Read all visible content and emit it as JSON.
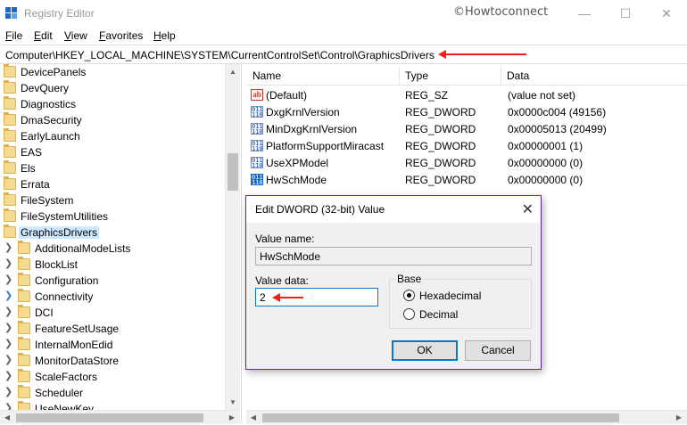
{
  "window": {
    "title": "Registry Editor",
    "watermark": "©Howtoconnect",
    "minimize": "—",
    "maximize": "☐",
    "close": "✕"
  },
  "menu": [
    {
      "label": "File",
      "u": "F",
      "rest": "ile"
    },
    {
      "label": "Edit",
      "u": "E",
      "rest": "dit"
    },
    {
      "label": "View",
      "u": "V",
      "rest": "iew"
    },
    {
      "label": "Favorites",
      "u": "F",
      "rest": "avorites"
    },
    {
      "label": "Help",
      "u": "H",
      "rest": "elp"
    }
  ],
  "address": "Computer\\HKEY_LOCAL_MACHINE\\SYSTEM\\CurrentControlSet\\Control\\GraphicsDrivers",
  "tree": {
    "level1": [
      "DevicePanels",
      "DevQuery",
      "Diagnostics",
      "DmaSecurity",
      "EarlyLaunch",
      "EAS",
      "Els",
      "Errata",
      "FileSystem",
      "FileSystemUtilities",
      "GraphicsDrivers"
    ],
    "level2": [
      "AdditionalModeLists",
      "BlockList",
      "Configuration",
      "Connectivity",
      "DCI",
      "FeatureSetUsage",
      "InternalMonEdid",
      "MonitorDataStore",
      "ScaleFactors",
      "Scheduler",
      "UseNewKey"
    ]
  },
  "list": {
    "headers": {
      "name": "Name",
      "type": "Type",
      "data": "Data"
    },
    "rows": [
      {
        "name": "(Default)",
        "type": "REG_SZ",
        "data": "(value not set)",
        "icon": "ab"
      },
      {
        "name": "DxgKrnlVersion",
        "type": "REG_DWORD",
        "data": "0x0000c004 (49156)",
        "icon": "011"
      },
      {
        "name": "MinDxgKrnlVersion",
        "type": "REG_DWORD",
        "data": "0x00005013 (20499)",
        "icon": "011"
      },
      {
        "name": "PlatformSupportMiracast",
        "type": "REG_DWORD",
        "data": "0x00000001 (1)",
        "icon": "011"
      },
      {
        "name": "UseXPModel",
        "type": "REG_DWORD",
        "data": "0x00000000 (0)",
        "icon": "011"
      },
      {
        "name": "HwSchMode",
        "type": "REG_DWORD",
        "data": "0x00000000 (0)",
        "icon": "011"
      }
    ]
  },
  "dialog": {
    "title": "Edit DWORD (32-bit) Value",
    "close": "✕",
    "value_name_label": "Value name:",
    "value_name": "HwSchMode",
    "value_data_label": "Value data:",
    "value_data": "2",
    "base_label": "Base",
    "hex_label": "Hexadecimal",
    "dec_label": "Decimal",
    "ok": "OK",
    "cancel": "Cancel"
  },
  "colors": {
    "accent_red": "#e8231a",
    "selection": "#cce8ff",
    "dialog_border": "#5e2aa0"
  }
}
